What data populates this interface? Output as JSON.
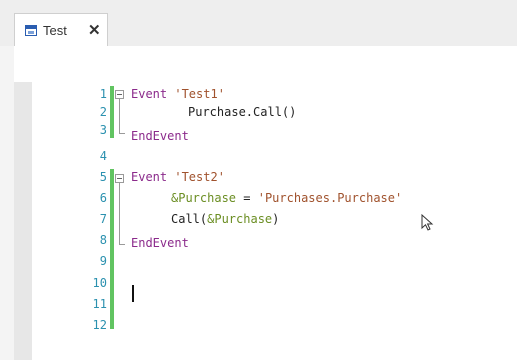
{
  "tab": {
    "title": "Test",
    "close": "✕"
  },
  "editor": {
    "line_numbers": [
      "1",
      "2",
      "3",
      "4",
      "5",
      "6",
      "7",
      "8",
      "9",
      "10",
      "11",
      "12"
    ],
    "code": {
      "l1_kw": "Event ",
      "l1_str": "'Test1'",
      "l2": "Purchase.Call()",
      "l3_kw": "EndEvent",
      "l5_kw": "Event ",
      "l5_str": "'Test2'",
      "l6_var": "&Purchase",
      "l6_op": " = ",
      "l6_str": "'Purchases.Purchase'",
      "l7_call": "Call(",
      "l7_var": "&Purchase",
      "l7_close": ")",
      "l8_kw": "EndEvent"
    }
  },
  "colors": {
    "keyword": "#8b2a8b",
    "string": "#a0522d",
    "variable": "#6b8e23",
    "line_number": "#2b91af",
    "change_bar": "#61c461"
  },
  "icons": {
    "tab": "document-icon",
    "close": "close-icon",
    "fold": "fold-collapse-icon",
    "cursor": "mouse-pointer-icon"
  }
}
